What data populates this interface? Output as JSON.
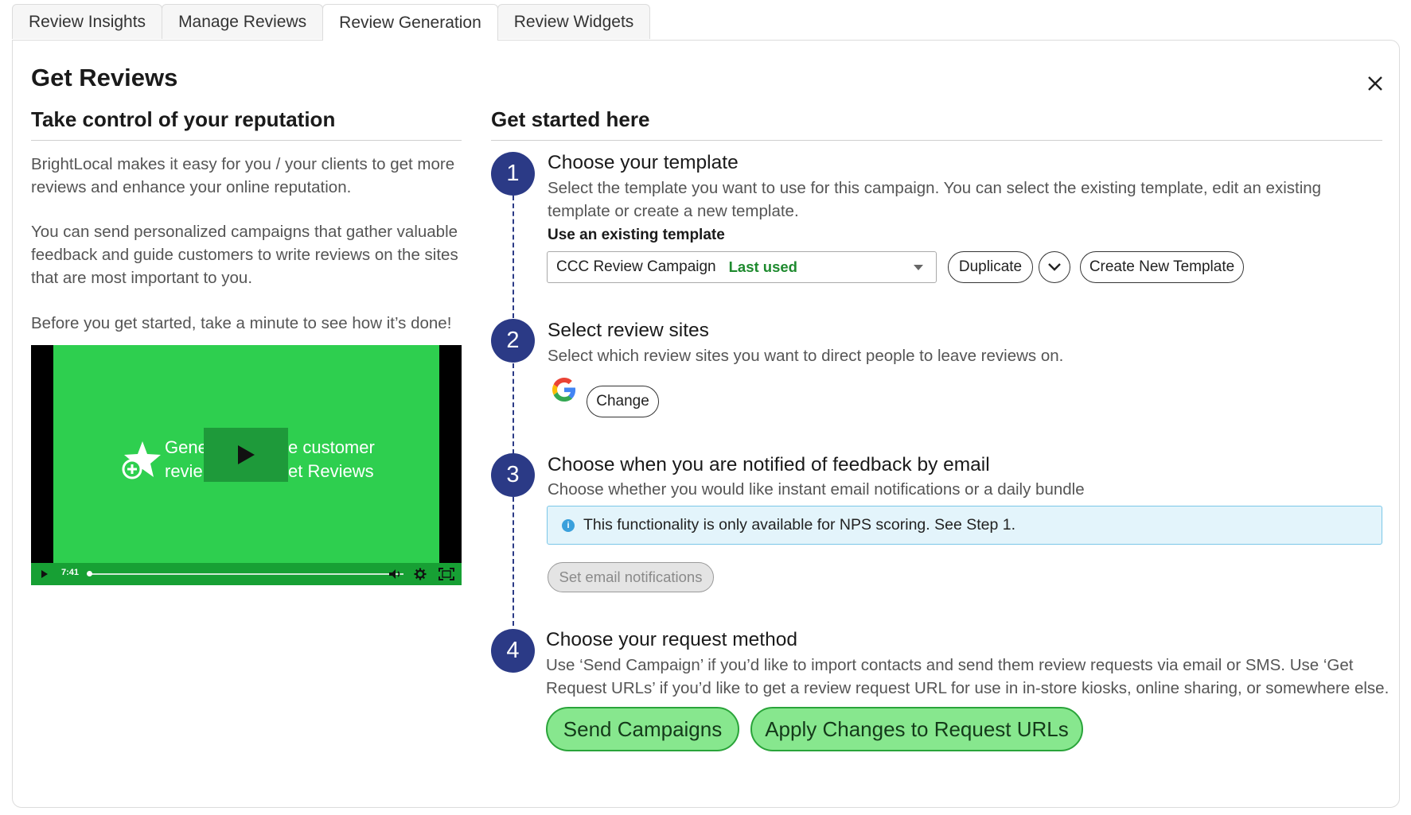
{
  "tabs": [
    {
      "label": "Review Insights",
      "active": false
    },
    {
      "label": "Manage Reviews",
      "active": false
    },
    {
      "label": "Review Generation",
      "active": true
    },
    {
      "label": "Review Widgets",
      "active": false
    }
  ],
  "page": {
    "title": "Get Reviews"
  },
  "left": {
    "heading": "Take control of your reputation",
    "paragraphs": [
      "BrightLocal makes it easy for you / your clients to get more reviews and enhance your online reputation.",
      "You can send personalized campaigns that gather valuable feedback and guide customers to write reviews on the sites that are most important to you.",
      "Before you get started, take a minute to see how it’s done!"
    ],
    "video": {
      "line1_a": "Gene",
      "line1_b": "e customer",
      "line2_a": "revie",
      "line2_b": "et Reviews",
      "duration": "7:41",
      "progress": 0.0
    }
  },
  "right": {
    "heading": "Get started here",
    "steps": [
      {
        "number": "1",
        "title": "Choose your template",
        "description": "Select the template you want to use for this campaign. You can select the existing template, edit an existing template or create a new template.",
        "sublabel": "Use an existing template",
        "select_value": "CCC Review Campaign",
        "select_badge": "Last used",
        "duplicate_label": "Duplicate",
        "create_label": "Create New Template"
      },
      {
        "number": "2",
        "title": "Select review sites",
        "description": "Select which review sites you want to direct people to leave reviews on.",
        "change_label": "Change",
        "site_icon": "google-icon"
      },
      {
        "number": "3",
        "title": "Choose when you are notified of feedback by email",
        "description": "Choose whether you would like instant email notifications or a daily bundle",
        "info_text": "This functionality is only available for NPS scoring. See Step 1.",
        "notify_button": "Set email notifications"
      },
      {
        "number": "4",
        "title": "Choose your request method",
        "description": "Use ‘Send Campaign’ if you’d like to import contacts and send them review requests via email or SMS. Use ‘Get Request URLs’ if you’d like to get a review request URL for use in in-store kiosks, online sharing, or somewhere else.",
        "send_label": "Send Campaigns",
        "apply_label": "Apply Changes to Request URLs"
      }
    ]
  },
  "colors": {
    "step_circle": "#2b3a86",
    "primary_green": "#87e78e",
    "video_green": "#2ecf4f",
    "info_bg": "#e3f4fb"
  }
}
